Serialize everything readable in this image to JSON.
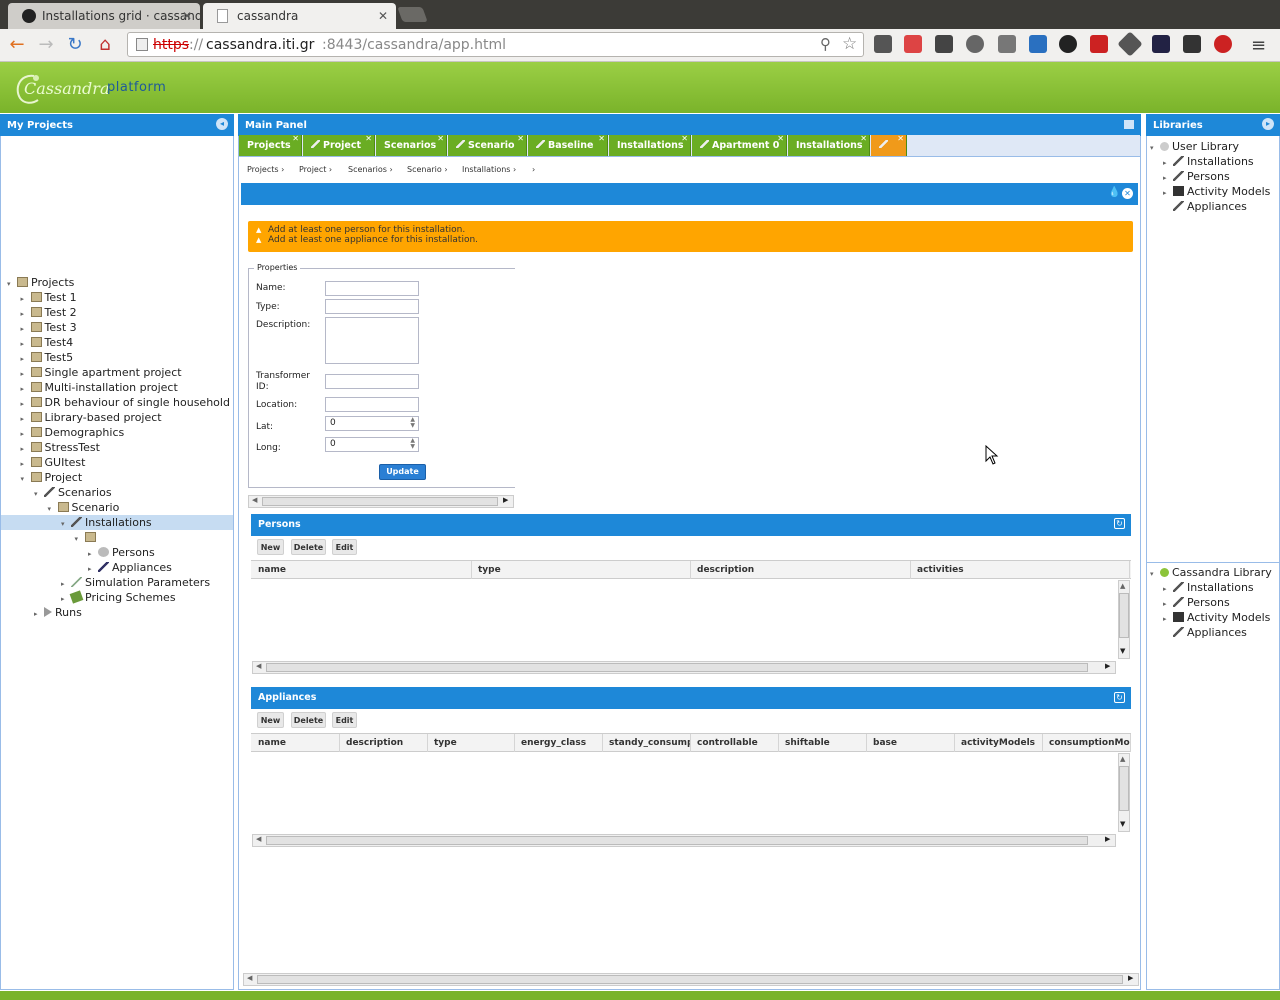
{
  "browser": {
    "tabs": [
      {
        "title": "Installations grid · cassandr"
      },
      {
        "title": "cassandra"
      }
    ],
    "url_scheme": "https",
    "url_host": "cassandra.iti.gr",
    "url_rest": ":8443/cassandra/app.html"
  },
  "app": {
    "logo": "Cassandra",
    "subtitle": "platform"
  },
  "left_panel": {
    "title": "My Projects",
    "tree": [
      {
        "label": "Projects",
        "indent": 0,
        "icon": "folder-icon",
        "exp": "▾"
      },
      {
        "label": "Test 1",
        "indent": 1,
        "icon": "folder-icon",
        "exp": "▸"
      },
      {
        "label": "Test 2",
        "indent": 1,
        "icon": "folder-icon",
        "exp": "▸"
      },
      {
        "label": "Test 3",
        "indent": 1,
        "icon": "folder-icon",
        "exp": "▸"
      },
      {
        "label": "Test4",
        "indent": 1,
        "icon": "folder-icon",
        "exp": "▸"
      },
      {
        "label": "Test5",
        "indent": 1,
        "icon": "folder-icon",
        "exp": "▸"
      },
      {
        "label": "Single apartment project",
        "indent": 1,
        "icon": "folder-icon",
        "exp": "▸"
      },
      {
        "label": "Multi-installation project",
        "indent": 1,
        "icon": "folder-icon",
        "exp": "▸"
      },
      {
        "label": "DR behaviour of single household",
        "indent": 1,
        "icon": "folder-icon",
        "exp": "▸"
      },
      {
        "label": "Library-based project",
        "indent": 1,
        "icon": "folder-icon",
        "exp": "▸"
      },
      {
        "label": "Demographics",
        "indent": 1,
        "icon": "folder-icon",
        "exp": "▸"
      },
      {
        "label": "StressTest",
        "indent": 1,
        "icon": "folder-icon",
        "exp": "▸"
      },
      {
        "label": "GUItest",
        "indent": 1,
        "icon": "folder-icon",
        "exp": "▸"
      },
      {
        "label": "Project",
        "indent": 1,
        "icon": "folder-icon",
        "exp": "▾"
      },
      {
        "label": "Scenarios",
        "indent": 2,
        "icon": "wand-icon",
        "exp": "▾"
      },
      {
        "label": "Scenario",
        "indent": 3,
        "icon": "folder-icon",
        "exp": "▾"
      },
      {
        "label": "Installations",
        "indent": 4,
        "icon": "wand-icon",
        "exp": "▾",
        "selected": true
      },
      {
        "label": "",
        "indent": 5,
        "icon": "folder-icon",
        "exp": "▾"
      },
      {
        "label": "Persons",
        "indent": 6,
        "icon": "person-icon",
        "exp": "▸"
      },
      {
        "label": "Appliances",
        "indent": 6,
        "icon": "plug-icon",
        "exp": "▸"
      },
      {
        "label": "Simulation Parameters",
        "indent": 4,
        "icon": "chart-icon",
        "exp": "▸"
      },
      {
        "label": "Pricing Schemes",
        "indent": 4,
        "icon": "money-icon",
        "exp": "▸"
      },
      {
        "label": "Runs",
        "indent": 2,
        "icon": "play-icon",
        "exp": "▸"
      }
    ]
  },
  "main_panel": {
    "title": "Main Panel",
    "tabs": [
      {
        "label": "Projects"
      },
      {
        "label": "Project"
      },
      {
        "label": "Scenarios"
      },
      {
        "label": "Scenario"
      },
      {
        "label": "Baseline"
      },
      {
        "label": "Installations"
      },
      {
        "label": "Apartment 0"
      },
      {
        "label": "Installations"
      },
      {
        "label": ""
      }
    ],
    "breadcrumbs": [
      "Projects ›",
      "Project ›",
      "Scenarios ›",
      "Scenario ›",
      "Installations ›",
      "›"
    ],
    "warnings": [
      "Add at least one person for this installation.",
      "Add at least one appliance for this installation."
    ],
    "properties": {
      "legend": "Properties",
      "name_label": "Name:",
      "type_label": "Type:",
      "description_label": "Description:",
      "transformer_label": "Transformer ID:",
      "location_label": "Location:",
      "lat_label": "Lat:",
      "long_label": "Long:",
      "lat_value": "0",
      "long_value": "0",
      "update_label": "Update"
    },
    "persons": {
      "title": "Persons",
      "buttons": [
        "New",
        "Delete",
        "Edit"
      ],
      "columns": [
        "name",
        "type",
        "description",
        "activities"
      ]
    },
    "appliances": {
      "title": "Appliances",
      "buttons": [
        "New",
        "Delete",
        "Edit"
      ],
      "columns": [
        "name",
        "description",
        "type",
        "energy_class",
        "standy_consumpt",
        "controllable",
        "shiftable",
        "base",
        "activityModels",
        "consumptionMode"
      ]
    }
  },
  "right_panel": {
    "title": "Libraries",
    "user_library": {
      "root": "User Library",
      "items": [
        "Installations",
        "Persons",
        "Activity Models",
        "Appliances"
      ]
    },
    "cassandra_library": {
      "root": "Cassandra Library",
      "items": [
        "Installations",
        "Persons",
        "Activity Models",
        "Appliances"
      ]
    }
  },
  "colors": {
    "accent_blue": "#1e88d8",
    "tab_green": "#6aad23",
    "warning_orange": "#ffa500",
    "header_green": "#8cc43a"
  }
}
